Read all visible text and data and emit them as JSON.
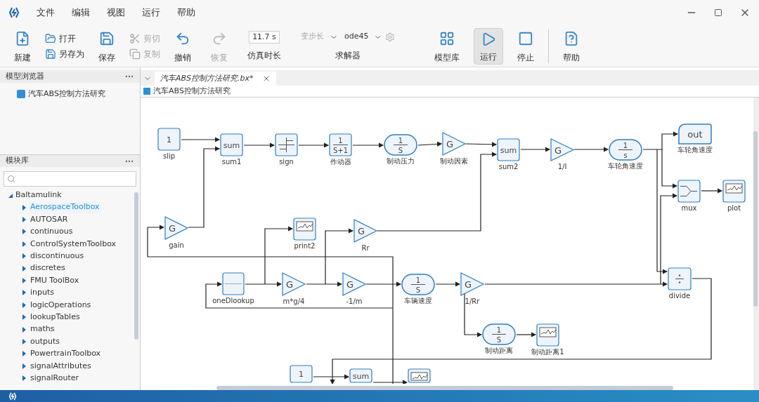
{
  "menu": [
    "文件",
    "编辑",
    "视图",
    "运行",
    "帮助"
  ],
  "toolbar": {
    "new": {
      "label": "新建"
    },
    "open": {
      "label": "打开"
    },
    "save_as": {
      "label": "另存为"
    },
    "save": {
      "label": "保存"
    },
    "cut": {
      "label": "剪切",
      "disabled": true
    },
    "copy": {
      "label": "复制",
      "disabled": true
    },
    "undo": {
      "label": "撤销",
      "disabled": false
    },
    "redo": {
      "label": "恢复",
      "disabled": true
    },
    "sim_time": {
      "value": "11.7 s",
      "label": "仿真时长"
    },
    "solver": {
      "step_type": "变步长",
      "step_disabled": true,
      "method": "ode45",
      "label": "求解器"
    },
    "library": {
      "label": "模型库"
    },
    "run": {
      "label": "运行",
      "active": true
    },
    "stop": {
      "label": "停止"
    },
    "help": {
      "label": "帮助"
    }
  },
  "model_browser": {
    "title": "模型浏览器",
    "items": [
      {
        "label": "汽车ABS控制方法研究"
      }
    ]
  },
  "library": {
    "title": "模块库",
    "tree": [
      {
        "label": "Baltamulink",
        "expanded": true,
        "children": [
          {
            "label": "AerospaceToolbox",
            "selected": true
          },
          {
            "label": "AUTOSAR",
            "selected": false
          },
          {
            "label": "continuous",
            "selected": false
          },
          {
            "label": "ControlSystemToolbox",
            "selected": false
          },
          {
            "label": "discontinuous",
            "selected": false
          },
          {
            "label": "discretes",
            "selected": false
          },
          {
            "label": "FMU ToolBox",
            "selected": false
          },
          {
            "label": "inputs",
            "selected": false
          },
          {
            "label": "logicOperations",
            "selected": false
          },
          {
            "label": "lookupTables",
            "selected": false
          },
          {
            "label": "maths",
            "selected": false
          },
          {
            "label": "outputs",
            "selected": false
          },
          {
            "label": "PowertrainToolbox",
            "selected": false
          },
          {
            "label": "signalAttributes",
            "selected": false
          },
          {
            "label": "signalRouter",
            "selected": false
          }
        ]
      }
    ]
  },
  "editor": {
    "tab": {
      "label": "汽车ABS控制方法研究.bx*",
      "modified": true
    },
    "breadcrumb": "汽车ABS控制方法研究",
    "blocks": [
      {
        "kind": "const",
        "text": "1",
        "label": "slip"
      },
      {
        "kind": "sum",
        "text": "sum",
        "label": "sum1"
      },
      {
        "kind": "sign",
        "label": "sign"
      },
      {
        "kind": "tf",
        "num": "1",
        "den": "S+1",
        "label": "作动器"
      },
      {
        "kind": "integrator",
        "num": "1",
        "den": "S",
        "label": "制动压力"
      },
      {
        "kind": "gain",
        "text": "G",
        "label": "制动因素"
      },
      {
        "kind": "sum",
        "text": "sum",
        "label": "sum2"
      },
      {
        "kind": "gain",
        "text": "G",
        "label": "1/I"
      },
      {
        "kind": "integrator",
        "num": "1",
        "den": "s",
        "label": "车轮角速度"
      },
      {
        "kind": "out",
        "text": "out",
        "label": "车轮角速度"
      },
      {
        "kind": "mux",
        "label": "mux"
      },
      {
        "kind": "scope",
        "label": "plot"
      },
      {
        "kind": "gain",
        "text": "G",
        "label": "gain"
      },
      {
        "kind": "scope",
        "label": "print2"
      },
      {
        "kind": "gain",
        "text": "G",
        "label": "Rr"
      },
      {
        "kind": "lookup",
        "label": "oneDlookup"
      },
      {
        "kind": "gain",
        "text": "G",
        "label": "m*g/4"
      },
      {
        "kind": "gain",
        "text": "G",
        "label": "-1/m"
      },
      {
        "kind": "integrator",
        "num": "1",
        "den": "S",
        "label": "车辆速度"
      },
      {
        "kind": "gain",
        "text": "G",
        "label": "1/Rr"
      },
      {
        "kind": "divide",
        "label": "divide"
      },
      {
        "kind": "integrator",
        "num": "1",
        "den": "S",
        "label": "制动距离"
      },
      {
        "kind": "scope",
        "label": "制动距离1"
      },
      {
        "kind": "const",
        "text": "1"
      },
      {
        "kind": "sum",
        "text": "sum"
      },
      {
        "kind": "scope"
      }
    ]
  }
}
